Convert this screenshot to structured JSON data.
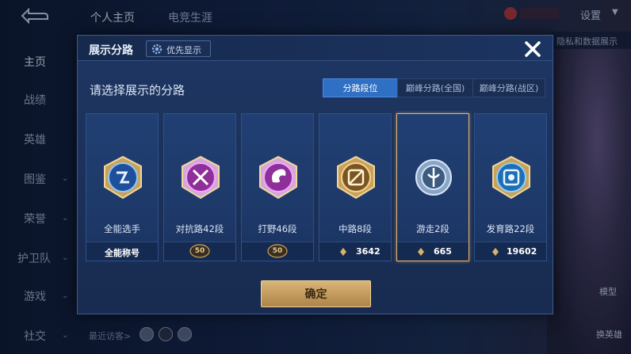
{
  "background": {
    "tabs": [
      "个人主页",
      "电竞生涯"
    ],
    "settings_label": "设置",
    "sidebar": [
      "主页",
      "战绩",
      "英雄",
      "图鉴",
      "荣誉",
      "护卫队",
      "游戏",
      "社交"
    ],
    "recent_visitors_label": "最近访客>",
    "right_hint": "隐私和数据展示",
    "model_label": "模型",
    "switch_hero_label": "换英雄"
  },
  "modal": {
    "title": "展示分路",
    "priority_label": "优先显示",
    "close_icon": "close-icon",
    "prompt": "请选择展示的分路",
    "segments": [
      {
        "label": "分路段位",
        "active": true
      },
      {
        "label": "巅峰分路(全国)",
        "active": false
      },
      {
        "label": "巅峰分路(战区)",
        "active": false
      }
    ],
    "cards": [
      {
        "name": "全能选手",
        "footer": "全能称号",
        "value": "",
        "badge": "",
        "emblem": "allround-emblem",
        "selected": false
      },
      {
        "name": "对抗路42段",
        "footer": "",
        "value": "",
        "badge": "50",
        "emblem": "clash-lane-emblem",
        "selected": false
      },
      {
        "name": "打野46段",
        "footer": "",
        "value": "",
        "badge": "50",
        "emblem": "jungle-emblem",
        "selected": false
      },
      {
        "name": "中路8段",
        "footer": "",
        "value": "3642",
        "badge": "",
        "emblem": "mid-lane-emblem",
        "selected": false
      },
      {
        "name": "游走2段",
        "footer": "",
        "value": "665",
        "badge": "",
        "emblem": "roam-emblem",
        "selected": true
      },
      {
        "name": "发育路22段",
        "footer": "",
        "value": "19602",
        "badge": "",
        "emblem": "farm-lane-emblem",
        "selected": false
      }
    ],
    "confirm_label": "确定"
  },
  "colors": {
    "accent_blue": "#2f6fc4",
    "gold": "#c29a5d",
    "selected_border": "#e7b66d"
  }
}
